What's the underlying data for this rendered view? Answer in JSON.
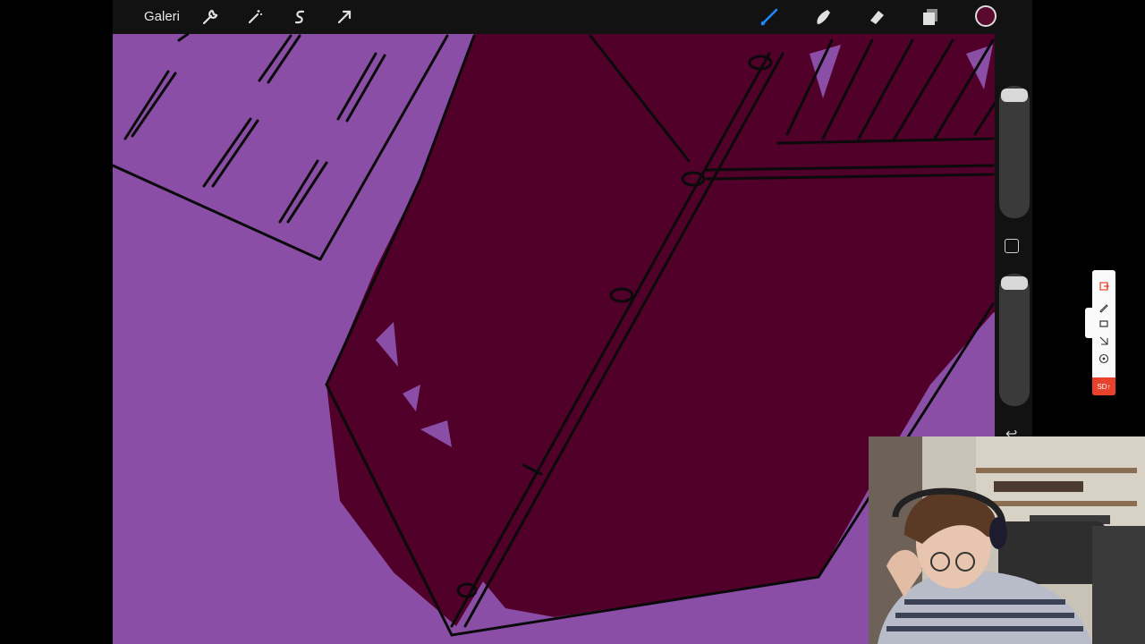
{
  "app": {
    "gallery_label": "Galeri",
    "toolbar_left": [
      {
        "icon": "wrench-icon"
      },
      {
        "icon": "magic-wand-icon"
      },
      {
        "icon": "selection-s-icon"
      },
      {
        "icon": "transform-arrow-icon"
      }
    ],
    "toolbar_right": [
      {
        "icon": "brush-icon"
      },
      {
        "icon": "smudge-icon"
      },
      {
        "icon": "eraser-icon"
      },
      {
        "icon": "layers-icon"
      }
    ],
    "active_color": "#5a0a2e"
  },
  "sidebar": {
    "undo_glyph": "↩"
  },
  "canvas": {
    "background_color": "#8a4ea6",
    "fill_color": "#51002a"
  },
  "floating_tool": {
    "record_label": "SD"
  }
}
